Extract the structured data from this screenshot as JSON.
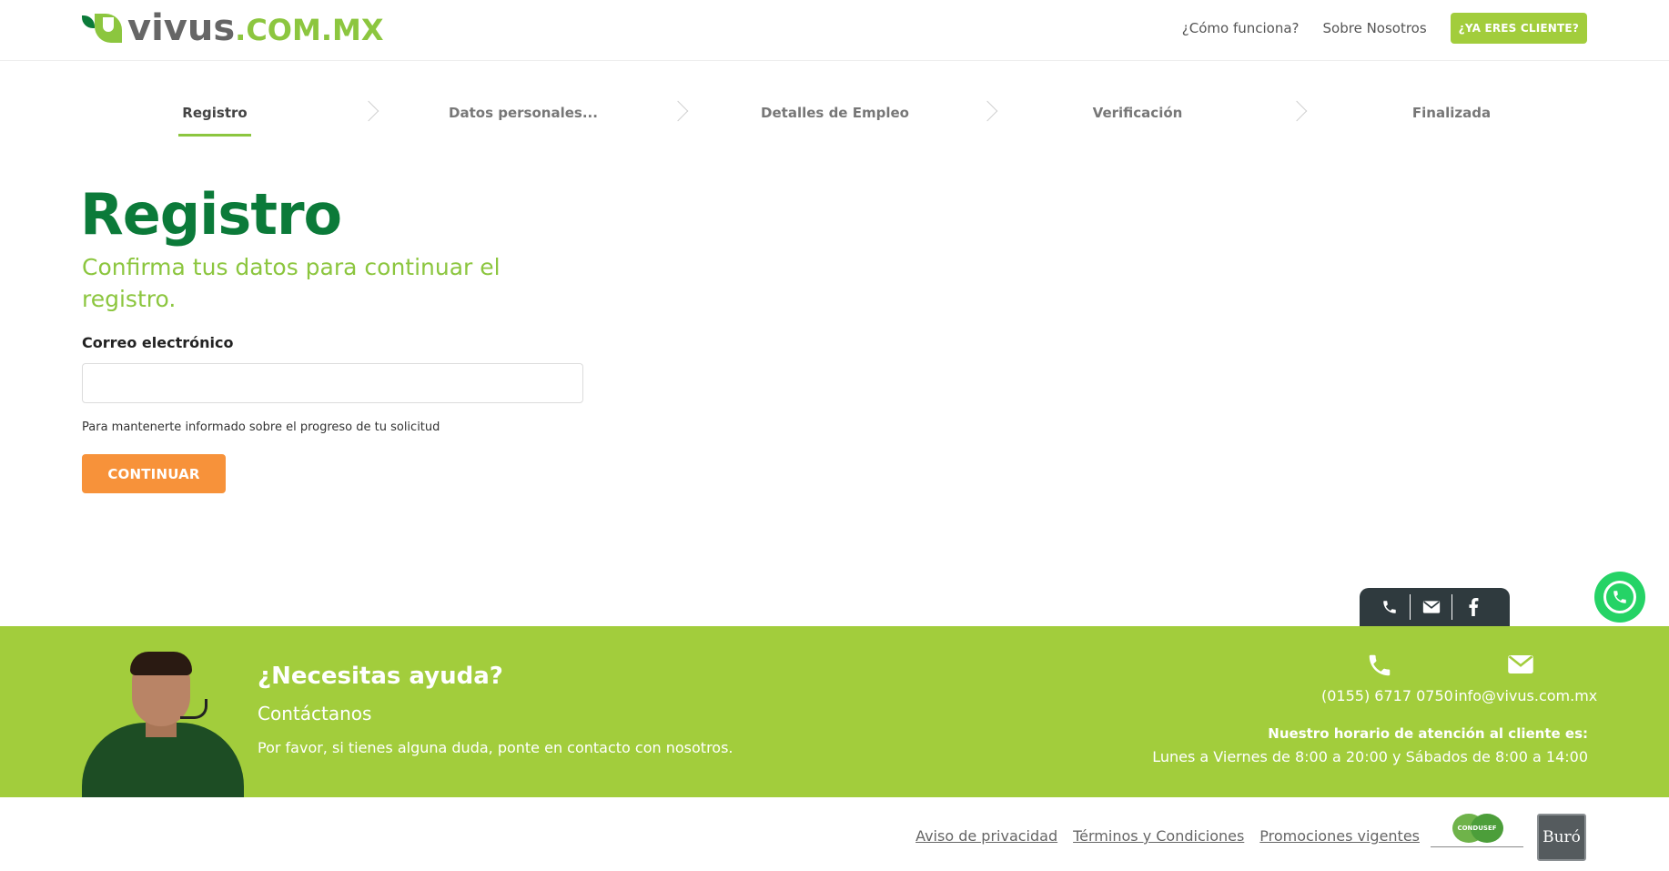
{
  "header": {
    "logo_main": "vivus",
    "logo_suffix": ".COM.MX",
    "nav": {
      "how_it_works": "¿Cómo funciona?",
      "about": "Sobre Nosotros",
      "client_button": "¿YA ERES CLIENTE?"
    }
  },
  "steps": [
    {
      "label": "Registro",
      "active": true
    },
    {
      "label": "Datos personales...",
      "active": false
    },
    {
      "label": "Detalles de Empleo",
      "active": false
    },
    {
      "label": "Verificación",
      "active": false
    },
    {
      "label": "Finalizada",
      "active": false
    }
  ],
  "form": {
    "title": "Registro",
    "subtitle": "Confirma tus datos para continuar el registro.",
    "email_label": "Correo electrónico",
    "email_value": "",
    "email_placeholder": "",
    "hint": "Para mantenerte informado sobre el progreso de tu solicitud",
    "continue_button": "CONTINUAR"
  },
  "float_tab": {
    "icons": [
      "phone-icon",
      "mail-icon",
      "facebook-icon"
    ]
  },
  "help": {
    "title": "¿Necesitas ayuda?",
    "subtitle": "Contáctanos",
    "text": "Por favor, si tienes alguna duda, ponte en contacto con nosotros.",
    "phone": "(0155) 6717 0750",
    "email": "info@vivus.com.mx",
    "hours_title": "Nuestro horario de atención al cliente es:",
    "hours_text": "Lunes a Viernes de 8:00 a 20:00 y Sábados de 8:00 a 14:00"
  },
  "footer": {
    "links": [
      "Aviso de privacidad",
      "Términos y Condiciones",
      "Promociones vigentes"
    ],
    "condusef_name": "CONDUSEF",
    "buro_label": "Buró"
  },
  "colors": {
    "brand_green": "#0b7a39",
    "light_green": "#a2cd3c",
    "accent_orange": "#f7923a",
    "whatsapp_green": "#25d366"
  }
}
